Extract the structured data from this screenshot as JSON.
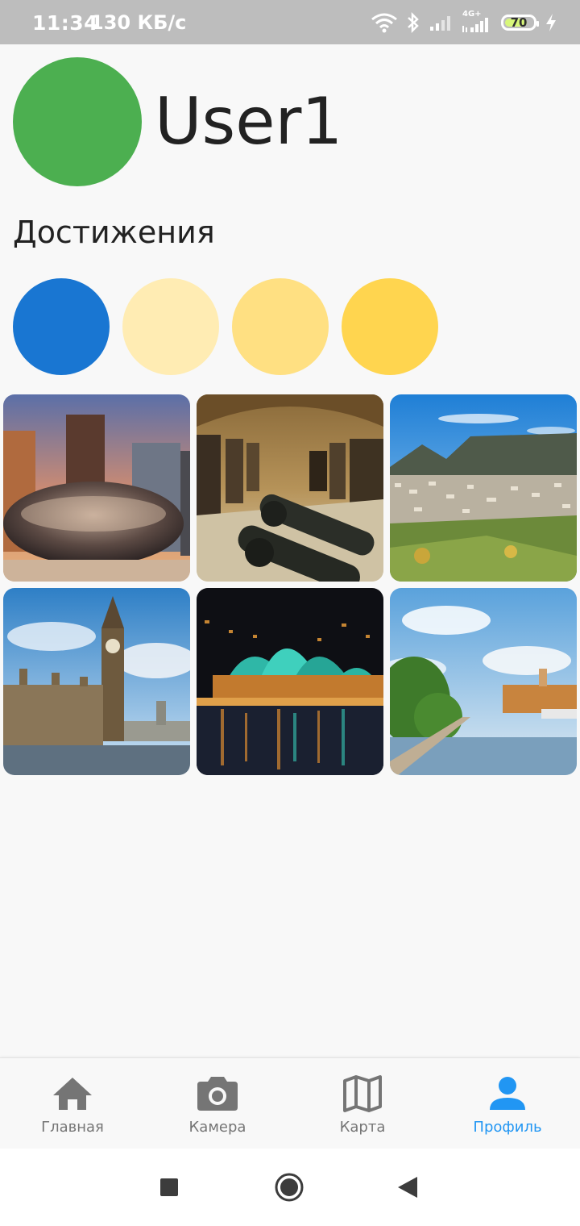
{
  "status_bar": {
    "time": "11:34",
    "network_speed": "130 КБ/с",
    "network_type": "4G+",
    "battery_level": "70",
    "icons": [
      "wifi-icon",
      "bluetooth-icon",
      "signal-icon",
      "signal-4g-icon",
      "battery-icon",
      "charging-icon"
    ]
  },
  "profile": {
    "username": "User1",
    "avatar_color": "#4caf50"
  },
  "achievements": {
    "title": "Достижения",
    "items": [
      {
        "color": "#1976d2"
      },
      {
        "color": "#ffecb3"
      },
      {
        "color": "#ffe082"
      },
      {
        "color": "#ffd54f"
      }
    ]
  },
  "photos": [
    {
      "subject": "chicago-cloud-gate"
    },
    {
      "subject": "museum-cannons-hall"
    },
    {
      "subject": "table-mountain-cape-town"
    },
    {
      "subject": "big-ben-london"
    },
    {
      "subject": "sydney-opera-house-night"
    },
    {
      "subject": "river-embankment-city"
    }
  ],
  "bottom_nav": {
    "items": [
      {
        "label": "Главная",
        "icon": "home-icon",
        "active": false
      },
      {
        "label": "Камера",
        "icon": "camera-icon",
        "active": false
      },
      {
        "label": "Карта",
        "icon": "map-icon",
        "active": false
      },
      {
        "label": "Профиль",
        "icon": "person-icon",
        "active": true
      }
    ],
    "active_color": "#2196f3",
    "inactive_color": "#757575"
  },
  "system_nav": {
    "icons": [
      "recents-square-icon",
      "home-circle-icon",
      "back-triangle-icon"
    ]
  }
}
